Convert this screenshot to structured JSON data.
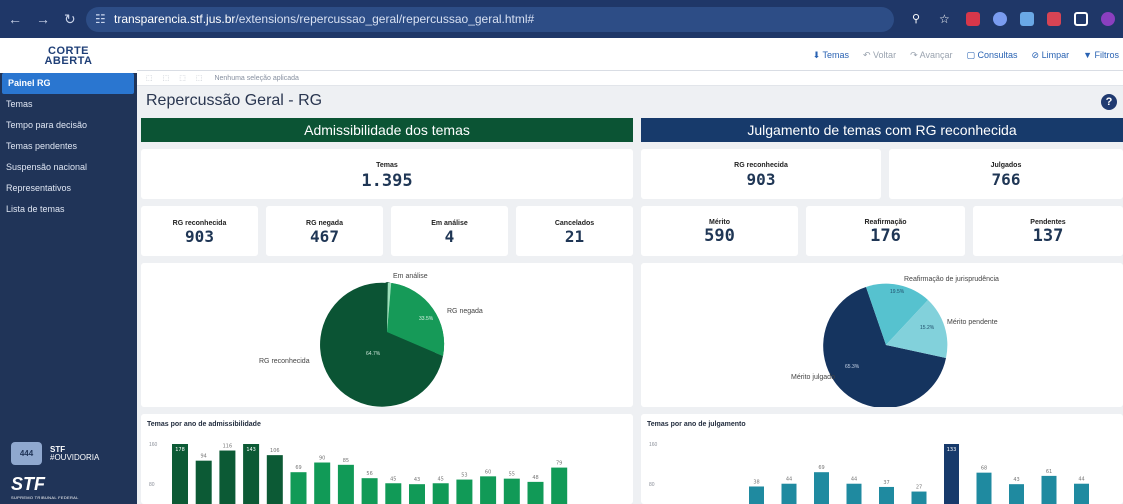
{
  "browser": {
    "url_host": "transparencia.stf.jus.br",
    "url_path": "/extensions/repercussao_geral/repercussao_geral.html#"
  },
  "brand": {
    "line1": "CORTE",
    "line2": "ABERTA"
  },
  "sidebar": {
    "items": [
      {
        "label": "Painel RG"
      },
      {
        "label": "Temas"
      },
      {
        "label": "Tempo para decisão"
      },
      {
        "label": "Temas pendentes"
      },
      {
        "label": "Suspensão nacional"
      },
      {
        "label": "Representativos"
      },
      {
        "label": "Lista de temas"
      }
    ],
    "ouvidoria": {
      "box": "444",
      "line1": "STF",
      "line2": "#OUVIDORIA"
    },
    "footer": {
      "logo": "STF",
      "sub": "SUPREMO TRIBUNAL FEDERAL"
    }
  },
  "toolbar": {
    "temas": "Temas",
    "voltar": "Voltar",
    "avancar": "Avançar",
    "consultas": "Consultas",
    "limpar": "Limpar",
    "filtros": "Filtros"
  },
  "selection": {
    "status": "Nenhuma seleção aplicada"
  },
  "page": {
    "title": "Repercussão Geral - RG"
  },
  "left": {
    "header": "Admissibilidade dos temas",
    "temas": {
      "label": "Temas",
      "value": "1.395"
    },
    "kpis": [
      {
        "label": "RG reconhecida",
        "value": "903"
      },
      {
        "label": "RG negada",
        "value": "467"
      },
      {
        "label": "Em análise",
        "value": "4"
      },
      {
        "label": "Cancelados",
        "value": "21"
      }
    ],
    "pie": {
      "labels": [
        "Em análise",
        "RG negada",
        "RG reconhecida"
      ],
      "inner": [
        "33.5%",
        "64.7%"
      ]
    },
    "bars_title": "Temas por ano de admissibilidade",
    "ticks": [
      "160",
      "80"
    ]
  },
  "right": {
    "header": "Julgamento de temas com RG reconhecida",
    "top": [
      {
        "label": "RG reconhecida",
        "value": "903"
      },
      {
        "label": "Julgados",
        "value": "766"
      }
    ],
    "kpis": [
      {
        "label": "Mérito",
        "value": "590"
      },
      {
        "label": "Reafirmação",
        "value": "176"
      },
      {
        "label": "Pendentes",
        "value": "137"
      }
    ],
    "pie": {
      "labels": [
        "Reafirmação de jurisprudência",
        "Mérito pendente",
        "Mérito julgado"
      ],
      "inner": [
        "19.5%",
        "15.2%",
        "65.3%"
      ]
    },
    "bars_title": "Temas por ano de julgamento",
    "ticks": [
      "160",
      "80"
    ]
  },
  "colors": {
    "green_dark": "#0c5a35",
    "navy": "#173a6b",
    "teal": "#56c2cf",
    "green_mid": "#119a57"
  },
  "chart_data": [
    {
      "type": "bar",
      "title": "Temas por ano de admissibilidade",
      "ylim": [
        0,
        160
      ],
      "values": [
        178,
        94,
        116,
        143,
        106,
        69,
        90,
        85,
        56,
        45,
        43,
        45,
        53,
        60,
        55,
        48,
        79
      ],
      "value_labels": [
        "178",
        "94",
        "116",
        "143",
        "106",
        "69",
        "90",
        "85",
        "56",
        "45",
        "43",
        "45",
        "53",
        "60",
        "55",
        "48",
        "79"
      ]
    },
    {
      "type": "bar",
      "title": "Temas por ano de julgamento",
      "ylim": [
        0,
        160
      ],
      "values": [
        38,
        44,
        69,
        44,
        37,
        27,
        133,
        68,
        43,
        61,
        44
      ],
      "value_labels": [
        "38",
        "44",
        "69",
        "44",
        "37",
        "27",
        "133",
        "68",
        "43",
        "61",
        "44"
      ]
    }
  ]
}
